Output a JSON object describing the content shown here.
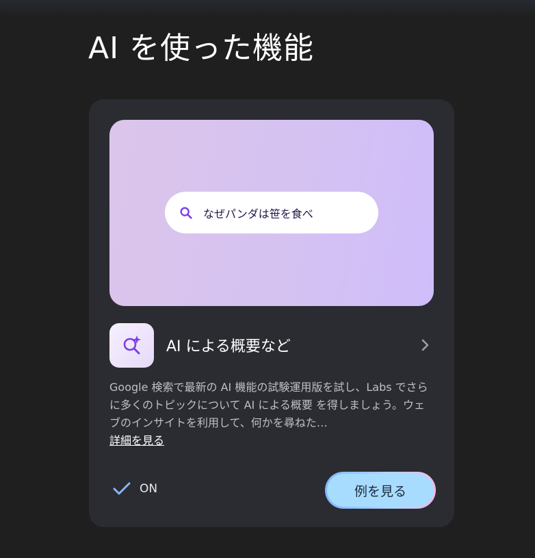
{
  "page": {
    "title": "AI を使った機能"
  },
  "hero": {
    "search_query": "なぜパンダは笹を食べ"
  },
  "feature": {
    "title": "AI による概要など",
    "description": "Google 検索で最新の AI 機能の試験運用版を試し、Labs でさらに多くのトピックについて AI による概要 を得しましょう。ウェブのインサイトを利用して、何かを尋ねた…",
    "more_link": "詳細を見る"
  },
  "status": {
    "label": "ON"
  },
  "actions": {
    "examples_label": "例を見る"
  },
  "colors": {
    "accent_purple": "#7b3fe4",
    "check_blue": "#8ab4f8",
    "button_fill": "#a8dcff"
  },
  "icons": {
    "search": "search-icon",
    "feature": "search-sparkle-icon",
    "chevron": "chevron-right-icon",
    "check": "check-icon"
  }
}
